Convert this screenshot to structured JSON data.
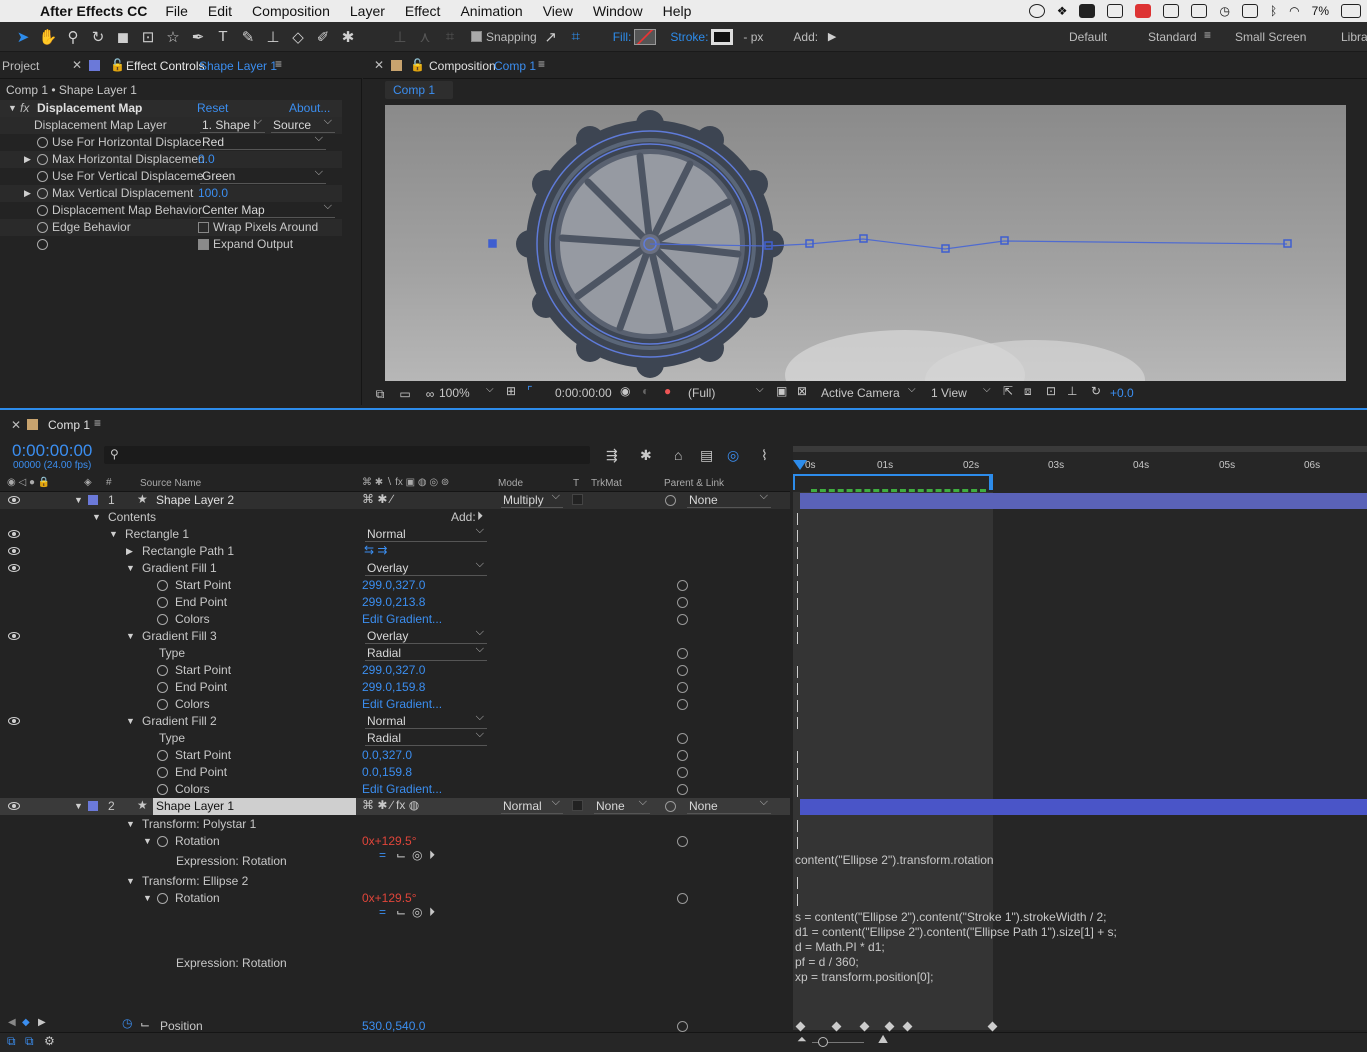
{
  "menubar": {
    "app": "After Effects CC",
    "items": [
      "File",
      "Edit",
      "Composition",
      "Layer",
      "Effect",
      "Animation",
      "View",
      "Window",
      "Help"
    ],
    "battery": "7%"
  },
  "toolbar": {
    "snapping": "Snapping",
    "fill_label": "Fill:",
    "stroke_label": "Stroke:",
    "stroke_px": "- px",
    "add_label": "Add:",
    "workspaces": [
      "Default",
      "Standard",
      "Small Screen",
      "Libra"
    ]
  },
  "project_panel": {
    "project_tab": "Project",
    "effect_tab": "Effect Controls",
    "effect_tab_layer": "Shape Layer 1",
    "breadcrumb": "Comp 1 • Shape Layer 1",
    "effect_name": "Displacement Map",
    "reset": "Reset",
    "about": "About...",
    "rows": [
      {
        "label": "Displacement Map Layer",
        "value": "1. Shape l",
        "value2": "Source"
      },
      {
        "label": "Use For Horizontal Displace",
        "value": "Red"
      },
      {
        "label": "Max Horizontal Displacemen",
        "value": "0.0"
      },
      {
        "label": "Use For Vertical Displaceme",
        "value": "Green"
      },
      {
        "label": "Max Vertical Displacement",
        "value": "100.0"
      },
      {
        "label": "Displacement Map Behavior",
        "value": "Center Map"
      },
      {
        "label": "Edge Behavior",
        "value": "Wrap Pixels Around"
      },
      {
        "label": "",
        "value": "Expand Output"
      }
    ]
  },
  "comp_panel": {
    "tab_prefix": "Composition",
    "tab_name": "Comp 1",
    "sub_tab": "Comp 1",
    "zoom": "100%",
    "time": "0:00:00:00",
    "resolution": "(Full)",
    "camera": "Active Camera",
    "views": "1 View",
    "exposure": "+0.0"
  },
  "timeline": {
    "tab": "Comp 1",
    "timecode": "0:00:00:00",
    "fps": "00000 (24.00 fps)",
    "headers": {
      "source_name": "Source Name",
      "mode": "Mode",
      "t": "T",
      "trkmat": "TrkMat",
      "parent": "Parent & Link"
    },
    "ruler": [
      "0s",
      "01s",
      "02s",
      "03s",
      "04s",
      "05s",
      "06s"
    ],
    "rows": [
      {
        "indent": 0,
        "num": "1",
        "name": "Shape Layer 2",
        "mode": "Multiply",
        "parent": "None",
        "type": "layer"
      },
      {
        "indent": 1,
        "name": "Contents",
        "add": "Add:"
      },
      {
        "indent": 2,
        "name": "Rectangle 1",
        "value": "Normal",
        "kind": "dropdown"
      },
      {
        "indent": 3,
        "name": "Rectangle Path 1"
      },
      {
        "indent": 3,
        "name": "Gradient Fill 1",
        "value": "Overlay",
        "kind": "dropdown"
      },
      {
        "indent": 4,
        "name": "Start Point",
        "value": "299.0,327.0",
        "kind": "blue"
      },
      {
        "indent": 4,
        "name": "End Point",
        "value": "299.0,213.8",
        "kind": "blue"
      },
      {
        "indent": 4,
        "name": "Colors",
        "value": "Edit Gradient...",
        "kind": "blue"
      },
      {
        "indent": 3,
        "name": "Gradient Fill 3",
        "value": "Overlay",
        "kind": "dropdown"
      },
      {
        "indent": 4,
        "name": "Type",
        "value": "Radial",
        "kind": "dropdown"
      },
      {
        "indent": 4,
        "name": "Start Point",
        "value": "299.0,327.0",
        "kind": "blue"
      },
      {
        "indent": 4,
        "name": "End Point",
        "value": "299.0,159.8",
        "kind": "blue"
      },
      {
        "indent": 4,
        "name": "Colors",
        "value": "Edit Gradient...",
        "kind": "blue"
      },
      {
        "indent": 3,
        "name": "Gradient Fill 2",
        "value": "Normal",
        "kind": "dropdown"
      },
      {
        "indent": 4,
        "name": "Type",
        "value": "Radial",
        "kind": "dropdown"
      },
      {
        "indent": 4,
        "name": "Start Point",
        "value": "0.0,327.0",
        "kind": "blue"
      },
      {
        "indent": 4,
        "name": "End Point",
        "value": "0.0,159.8",
        "kind": "blue"
      },
      {
        "indent": 4,
        "name": "Colors",
        "value": "Edit Gradient...",
        "kind": "blue"
      },
      {
        "indent": 0,
        "num": "2",
        "name": "Shape Layer 1",
        "mode": "Normal",
        "trkmat": "None",
        "parent": "None",
        "type": "layer"
      },
      {
        "indent": 2,
        "name": "Transform: Polystar 1"
      },
      {
        "indent": 3,
        "name": "Rotation",
        "value": "0x+129.5°",
        "kind": "red"
      },
      {
        "indent": 4,
        "name": "Expression: Rotation",
        "kind": "expr"
      },
      {
        "indent": 2,
        "name": "Transform: Ellipse 2"
      },
      {
        "indent": 3,
        "name": "Rotation",
        "value": "0x+129.5°",
        "kind": "red"
      },
      {
        "indent": 4,
        "name": "Expression: Rotation",
        "kind": "expr"
      },
      {
        "indent": 3,
        "name": "Position",
        "value": "530.0,540.0",
        "kind": "blue"
      }
    ],
    "expression1": "content(\"Ellipse 2\").transform.rotation",
    "expression2": [
      "s = content(\"Ellipse 2\").content(\"Stroke 1\").strokeWidth / 2;",
      "d1 = content(\"Ellipse 2\").content(\"Ellipse Path 1\").size[1] + s;",
      "d = Math.PI * d1;",
      "pf = d / 360;",
      "xp = transform.position[0];"
    ]
  },
  "colors": {
    "accent": "#2d8ceb",
    "layer_label": "#6b79d9",
    "red_value": "#e0453a"
  }
}
